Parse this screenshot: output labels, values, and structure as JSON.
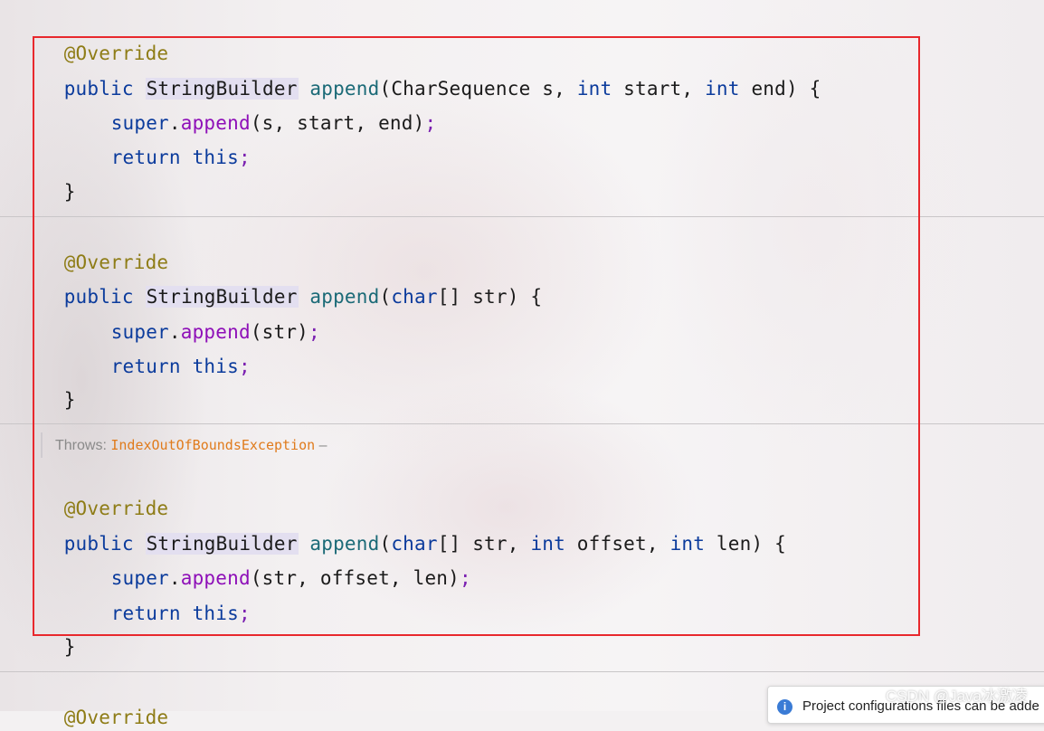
{
  "editor": {
    "blocks": [
      {
        "annotation": "@Override",
        "signature": {
          "modifier": "public",
          "return_type": "StringBuilder",
          "method": "append",
          "params_prefix": "(",
          "p1_type": "CharSequence",
          "p1_rest": " s, ",
          "p2_type": "int",
          "p2_rest": " start, ",
          "p3_type": "int",
          "p3_rest": " end) {"
        },
        "super_kw": "super",
        "dot": ".",
        "super_call": "append",
        "super_args": "(s, start, end)",
        "return_kw": "return",
        "this_kw": "this",
        "semicolon": ";",
        "close": "}"
      },
      {
        "annotation": "@Override",
        "signature": {
          "modifier": "public",
          "return_type": "StringBuilder",
          "method": "append",
          "params_prefix": "(",
          "p1_type": "char",
          "p1_rest": "[] str) {"
        },
        "super_kw": "super",
        "dot": ".",
        "super_call": "append",
        "super_args": "(str)",
        "return_kw": "return",
        "this_kw": "this",
        "semicolon": ";",
        "close": "}"
      },
      {
        "doc_throws_label": "Throws:",
        "doc_exception": "IndexOutOfBoundsException",
        "doc_dash": " –",
        "annotation": "@Override",
        "signature": {
          "modifier": "public",
          "return_type": "StringBuilder",
          "method": "append",
          "params_prefix": "(",
          "p1_type": "char",
          "p1_rest": "[] str, ",
          "p2_type": "int",
          "p2_rest": " offset, ",
          "p3_type": "int",
          "p3_rest": " len) {"
        },
        "super_kw": "super",
        "dot": ".",
        "super_call": "append",
        "super_args": "(str, offset, len)",
        "return_kw": "return",
        "this_kw": "this",
        "semicolon": ";",
        "close": "}"
      },
      {
        "annotation": "@Override"
      }
    ]
  },
  "watermark": "CSDN @Java冰激凌",
  "notification": {
    "icon": "info-icon",
    "text": "Project configurations files can be adde"
  },
  "colors": {
    "highlight_box": "#e8282d",
    "keyword": "#0b3b9c",
    "annotation": "#8e7c16",
    "method": "#1b6a77",
    "call": "#8e0fb8",
    "exception": "#e07b1c"
  }
}
